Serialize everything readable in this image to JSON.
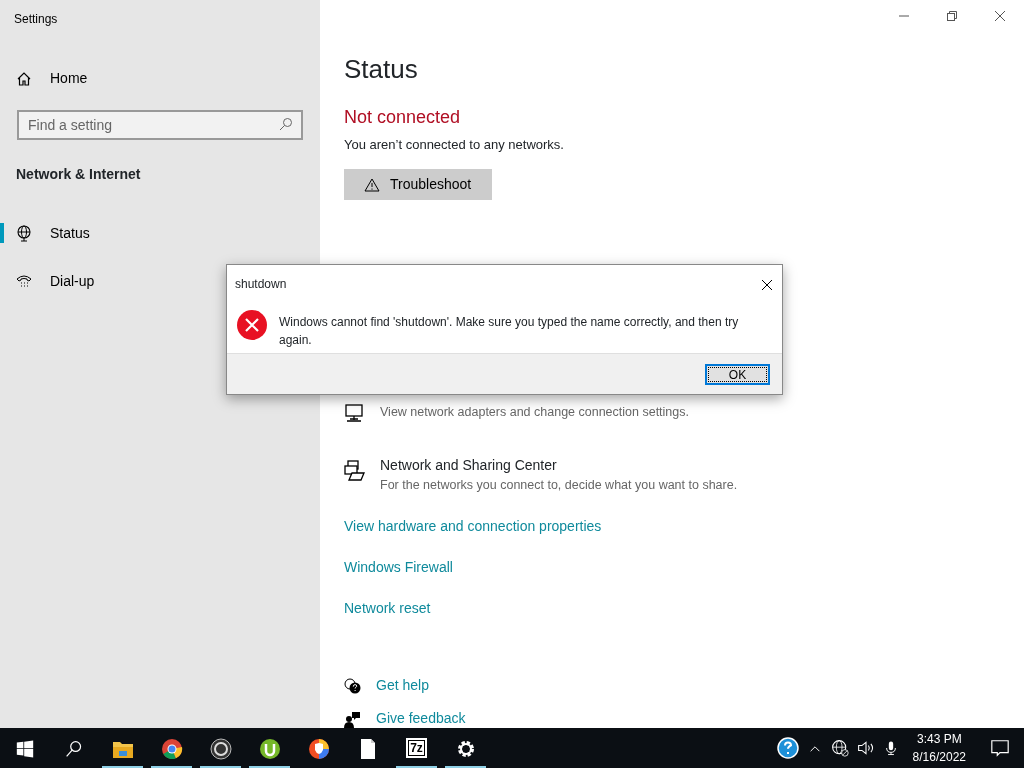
{
  "window": {
    "title": "Settings"
  },
  "sidebar": {
    "home": "Home",
    "search": {
      "placeholder": "Find a setting"
    },
    "heading": "Network & Internet",
    "items": [
      {
        "label": "Status",
        "kind": "globe",
        "selected": true
      },
      {
        "label": "Dial-up",
        "kind": "phone",
        "selected": false
      }
    ]
  },
  "main": {
    "title": "Status",
    "state": "Not connected",
    "description": "You aren’t connected to any networks.",
    "troubleshoot": "Troubleshoot",
    "options": [
      {
        "kind": "monitor",
        "subtitle": "View network adapters and change connection settings."
      },
      {
        "kind": "sharing",
        "title": "Network and Sharing Center",
        "subtitle": "For the networks you connect to, decide what you want to share."
      }
    ],
    "links": [
      "View hardware and connection properties",
      "Windows Firewall",
      "Network reset"
    ],
    "help": [
      {
        "kind": "help",
        "label": "Get help"
      },
      {
        "kind": "feedback",
        "label": "Give feedback"
      }
    ]
  },
  "dialog": {
    "title": "shutdown",
    "message": "Windows cannot find 'shutdown'. Make sure you typed the name correctly, and then try again.",
    "ok": "OK"
  },
  "taskbar": {
    "apps": [
      {
        "kind": "folder",
        "running": true
      },
      {
        "kind": "chrome",
        "running": true
      },
      {
        "kind": "obs",
        "running": true
      },
      {
        "kind": "torrent",
        "running": true
      },
      {
        "kind": "browser",
        "running": false
      },
      {
        "kind": "file",
        "running": false
      },
      {
        "kind": "archive",
        "label": "7z",
        "running": true
      },
      {
        "kind": "gear",
        "running": true
      }
    ],
    "time": "3:43 PM",
    "date": "8/16/2022"
  }
}
